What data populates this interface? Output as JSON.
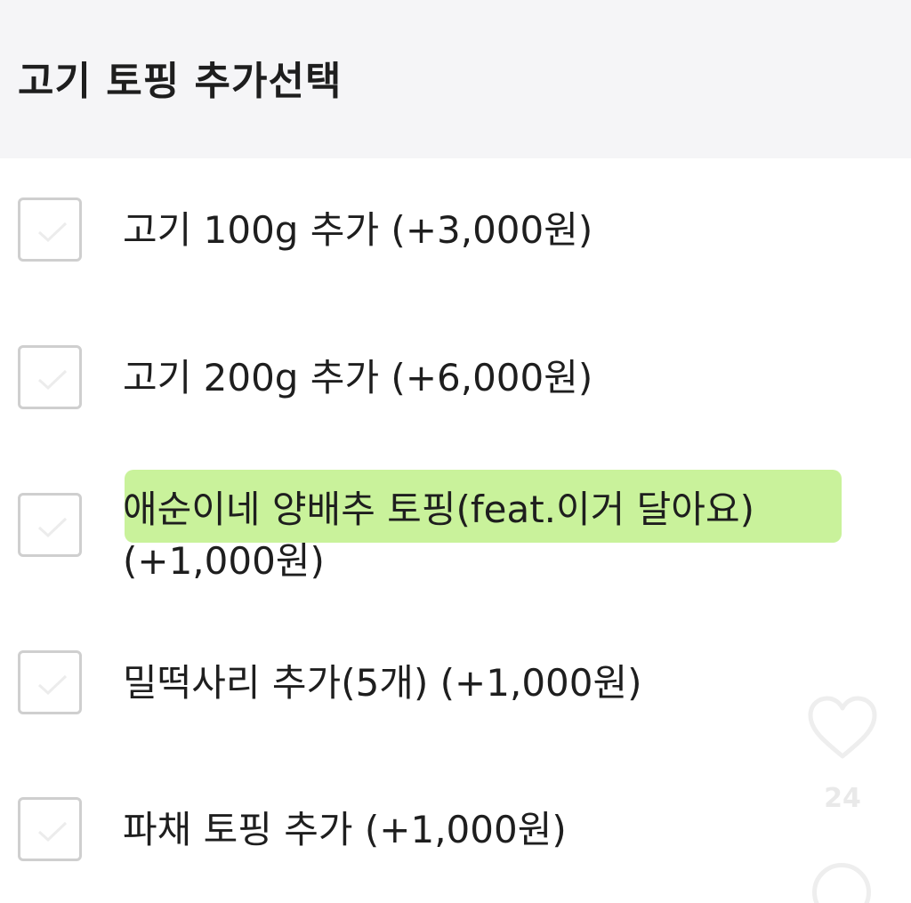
{
  "header": {
    "title": "고기 토핑 추가선택"
  },
  "options": [
    {
      "label": "고기 100g 추가 (+3,000원)",
      "checked": false
    },
    {
      "label": "고기 200g 추가 (+6,000원)",
      "checked": false
    },
    {
      "label_line1": "애순이네 양배추 토핑(feat.이거 달아요)",
      "label_line2": "(+1,000원)",
      "checked": false,
      "highlight_color": "#c9f29b"
    },
    {
      "label": "밀떡사리 추가(5개) (+1,000원)",
      "checked": false
    },
    {
      "label": "파채 토핑 추가 (+1,000원)",
      "checked": false
    }
  ],
  "overlay": {
    "like_icon": "heart-outline-icon",
    "like_count": "24",
    "comment_icon": "comment-bubble-icon"
  }
}
